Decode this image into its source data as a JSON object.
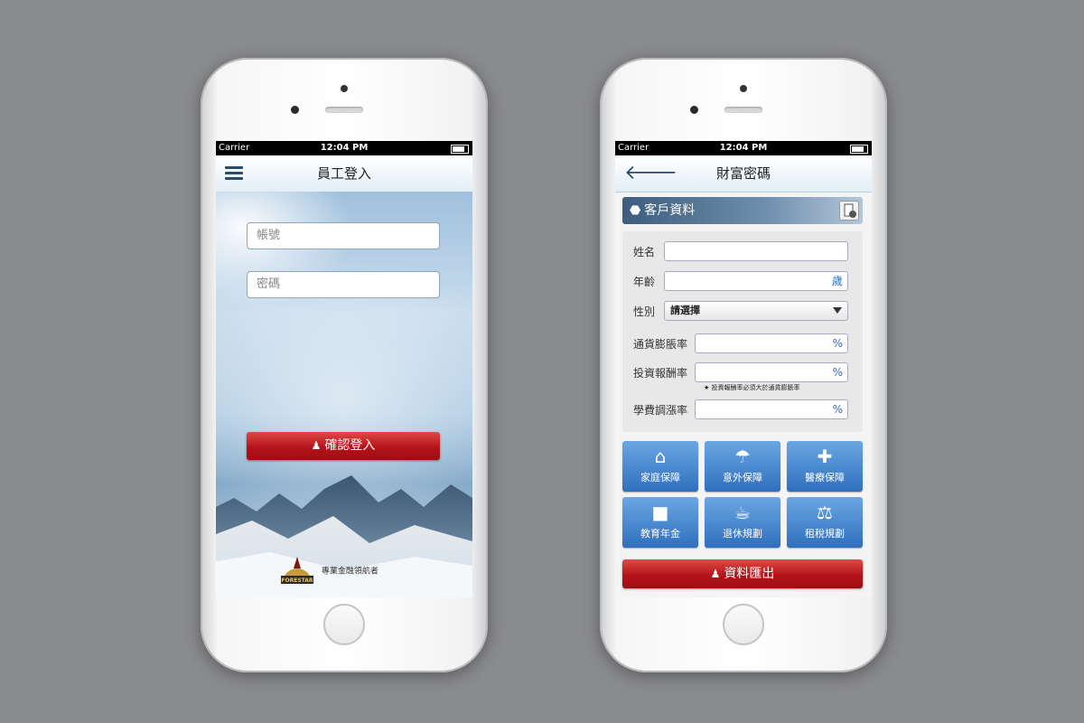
{
  "left_phone": {
    "status": {
      "carrier": "Carrier",
      "time": "12:04 PM"
    },
    "nav": {
      "title": "員工登入",
      "menu_icon": "hamburger-icon"
    },
    "account_placeholder": "帳號",
    "password_placeholder": "密碼",
    "login_button": "確認登入",
    "footer": {
      "brand": "FORESTAR",
      "tagline": "專業金融領航者"
    }
  },
  "right_phone": {
    "status": {
      "carrier": "Carrier",
      "time": "12:04 PM"
    },
    "nav": {
      "title": "財富密碼",
      "back_icon": "back-arrow-icon"
    },
    "section_title": "客戶資料",
    "form": {
      "name_label": "姓名",
      "name_value": "",
      "age_label": "年齡",
      "age_unit": "歲",
      "gender_label": "性別",
      "gender_value": "請選擇",
      "inflation_label": "通貨膨脹率",
      "inflation_unit": "%",
      "return_label": "投資報酬率",
      "return_unit": "%",
      "note": "★ 投資報酬率必須大於通貨膨脹率",
      "tuition_label": "學費調漲率",
      "tuition_unit": "%"
    },
    "tiles": [
      {
        "label": "家庭保障",
        "icon": "house-icon"
      },
      {
        "label": "意外保障",
        "icon": "umbrella-icon"
      },
      {
        "label": "醫療保障",
        "icon": "syringe-icon"
      },
      {
        "label": "教育年金",
        "icon": "graduation-cap-icon"
      },
      {
        "label": "退休規劃",
        "icon": "coffee-cup-icon"
      },
      {
        "label": "租稅規劃",
        "icon": "scales-icon"
      }
    ],
    "export_button": "資料匯出"
  },
  "colors": {
    "background": "#8a8b8d",
    "nav_blue": "#2c4a69",
    "red_button": "#b4131a",
    "tile_blue": "#2f6fbd"
  }
}
